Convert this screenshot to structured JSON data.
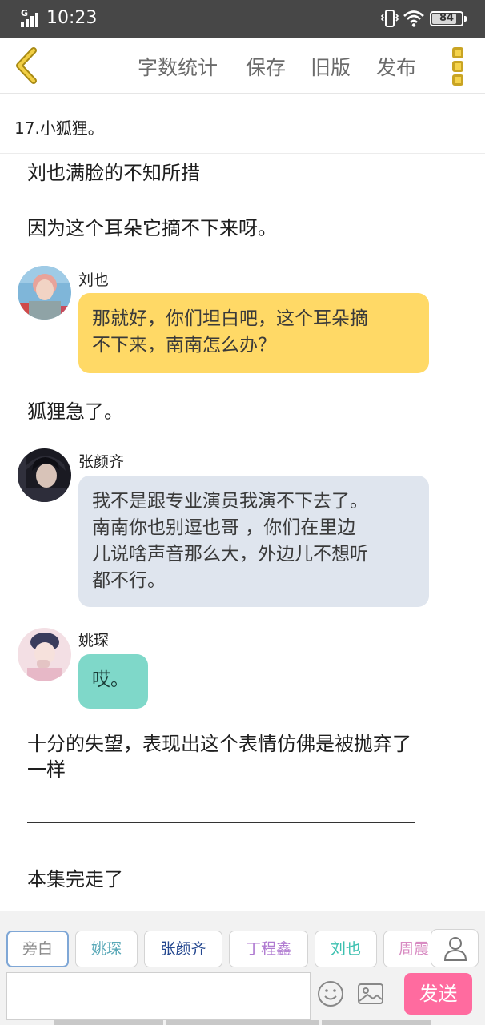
{
  "status_bar": {
    "network": "G",
    "time": "10:23",
    "battery": "84",
    "battery_level": 0.84
  },
  "toolbar": {
    "word_count": "字数统计",
    "save": "保存",
    "old_version": "旧版",
    "publish": "发布"
  },
  "chapter": {
    "title": "17.小狐狸。"
  },
  "story": {
    "narration_1": "刘也满脸的不知所措",
    "narration_2": "因为这个耳朵它摘不下来呀。",
    "message_1": {
      "sender": "刘也",
      "line_1": "那就好，你们坦白吧，这个耳朵摘",
      "line_2": "不下来，南南怎么办？",
      "color": "#ffd966"
    },
    "narration_3": "狐狸急了。",
    "message_2": {
      "sender": "张颜齐",
      "line_1": "我不是跟专业演员我演不下去了。",
      "line_2": "南南你也别逗也哥 ，你们在里边",
      "line_3": "儿说啥声音那么大，外边儿不想听",
      "line_4": "都不行。",
      "color": "#dfe5ee"
    },
    "message_3": {
      "sender": "姚琛",
      "text": "哎。",
      "color": "#7fd8c9"
    },
    "narration_4_line_1": "十分的失望，表现出这个表情仿佛是被抛弃了",
    "narration_4_line_2": "一样",
    "narration_5": "本集完走了"
  },
  "composer": {
    "characters": [
      {
        "label": "旁白",
        "color": "#8a8a8a"
      },
      {
        "label": "姚琛",
        "color": "#5aa9b8"
      },
      {
        "label": "张颜齐",
        "color": "#24478f"
      },
      {
        "label": "丁程鑫",
        "color": "#b07bd1"
      },
      {
        "label": "刘也",
        "color": "#3cc0b0"
      },
      {
        "label": "周震",
        "color": "#d88bc2"
      }
    ],
    "message_placeholder": "",
    "send": "发送",
    "accent": "#ff6b9f"
  }
}
